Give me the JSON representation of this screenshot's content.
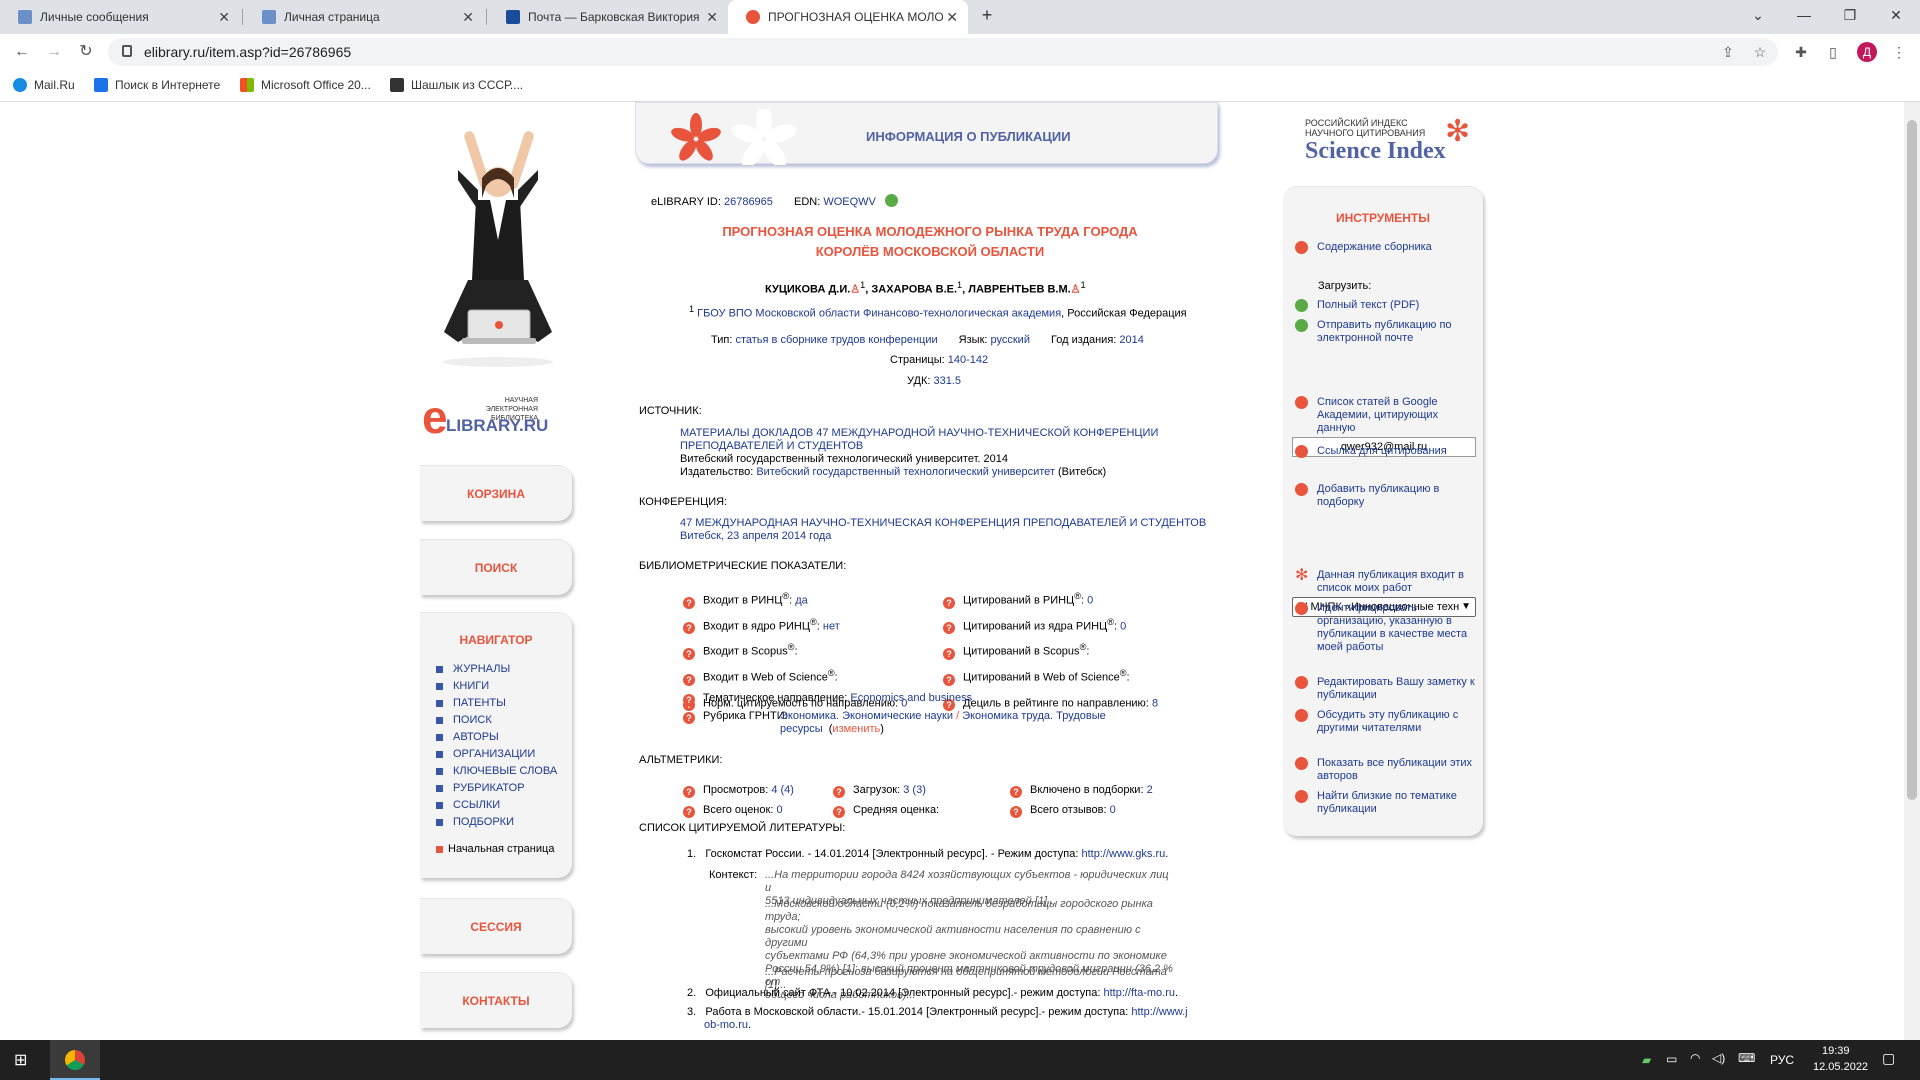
{
  "browser": {
    "tabs": [
      {
        "label": "Личные сообщения",
        "active": false
      },
      {
        "label": "Личная страница",
        "active": false
      },
      {
        "label": "Почта — Барковская Виктория",
        "active": false
      },
      {
        "label": "ПРОГНОЗНАЯ ОЦЕНКА МОЛОД",
        "active": true
      }
    ],
    "new_tab": "+",
    "url": "elibrary.ru/item.asp?id=26786965",
    "avatar_letter": "Д",
    "bookmarks": [
      "Mail.Ru",
      "Поиск в Интернете",
      "Microsoft Office 20...",
      "Шашлык из СССР...."
    ]
  },
  "left": {
    "logo_small": "НАУЧНАЯ ЭЛЕКТРОННАЯ БИБЛИОТЕКА",
    "logo_big": "LIBRARY.RU",
    "logo_e": "e",
    "cart": "КОРЗИНА",
    "search": "ПОИСК",
    "navigator": {
      "title": "НАВИГАТОР",
      "items": [
        "ЖУРНАЛЫ",
        "КНИГИ",
        "ПАТЕНТЫ",
        "ПОИСК",
        "АВТОРЫ",
        "ОРГАНИЗАЦИИ",
        "КЛЮЧЕВЫЕ СЛОВА",
        "РУБРИКАТОР",
        "ССЫЛКИ",
        "ПОДБОРКИ"
      ],
      "home": "Начальная страница"
    },
    "session": "СЕССИЯ",
    "contacts": "КОНТАКТЫ"
  },
  "header_box": {
    "title": "ИНФОРМАЦИЯ О ПУБЛИКАЦИИ"
  },
  "pub": {
    "elibrary_id_label": "eLIBRARY ID:",
    "elibrary_id": "26786965",
    "edn_label": "EDN:",
    "edn": "WOEQWV",
    "title_line1": "ПРОГНОЗНАЯ ОЦЕНКА МОЛОДЕЖНОГО РЫНКА ТРУДА ГОРОДА",
    "title_line2": "КОРОЛЁВ МОСКОВСКОЙ ОБЛАСТИ",
    "authors": [
      "КУЦИКОВА Д.И.",
      "ЗАХАРОВА В.Е.",
      "ЛАВРЕНТЬЕВ В.М."
    ],
    "author_sup": "1",
    "affiliation_sup": "1",
    "affiliation": "ГБОУ ВПО Московской области Финансово-технологическая академия",
    "country": ", Российская Федерация",
    "type_label": "Тип:",
    "type": "статья в сборнике трудов конференции",
    "lang_label": "Язык:",
    "lang": "русский",
    "year_label": "Год издания:",
    "year": "2014",
    "pages_label": "Страницы:",
    "pages": "140-142",
    "udk_label": "УДК:",
    "udk": "331.5"
  },
  "source": {
    "heading": "ИСТОЧНИК:",
    "title1": "МАТЕРИАЛЫ ДОКЛАДОВ 47 МЕЖДУНАРОДНОЙ НАУЧНО-ТЕХНИЧЕСКОЙ КОНФЕРЕНЦИИ",
    "title2": "ПРЕПОДАВАТЕЛЕЙ И СТУДЕНТОВ",
    "org": "Витебский государственный технологический университет. 2014",
    "publisher_label": "Издательство:",
    "publisher": "Витебский государственный технологический университет",
    "publisher_city": " (Витебск)"
  },
  "conference": {
    "heading": "КОНФЕРЕНЦИЯ:",
    "name": "47 МЕЖДУНАРОДНАЯ НАУЧНО-ТЕХНИЧЕСКАЯ КОНФЕРЕНЦИЯ ПРЕПОДАВАТЕЛЕЙ И СТУДЕНТОВ",
    "place": "Витебск, 23 апреля 2014 года"
  },
  "biblio": {
    "heading": "БИБЛИОМЕТРИЧЕСКИЕ ПОКАЗАТЕЛИ:",
    "left": [
      {
        "label": "Входит в РИНЦ",
        "sup": "®",
        "sep": ": ",
        "value": "да"
      },
      {
        "label": "Входит в ядро РИНЦ",
        "sup": "®",
        "sep": ": ",
        "value": "нет"
      },
      {
        "label": "Входит в Scopus",
        "sup": "®",
        "sep": ":",
        "value": ""
      },
      {
        "label": "Входит в Web of Science",
        "sup": "®",
        "sep": ":",
        "value": ""
      },
      {
        "label": "Норм. цитируемость по направлению:",
        "sup": "",
        "sep": " ",
        "value": "0"
      }
    ],
    "right": [
      {
        "label": "Цитирований в РИНЦ",
        "sup": "®",
        "sep": ": ",
        "value": "0"
      },
      {
        "label": "Цитирований из ядра РИНЦ",
        "sup": "®",
        "sep": ": ",
        "value": "0"
      },
      {
        "label": "Цитирований в Scopus",
        "sup": "®",
        "sep": ":",
        "value": ""
      },
      {
        "label": "Цитирований в Web of Science",
        "sup": "®",
        "sep": ":",
        "value": ""
      },
      {
        "label": "Дециль в рейтинге по направлению:",
        "sup": "",
        "sep": " ",
        "value": "8"
      }
    ],
    "theme_label": "Тематическое направление:",
    "theme": "Economics and business",
    "grnti_label": "Рубрика ГРНТИ:",
    "grnti1": "Экономика. Экономические науки",
    "grnti_sep": " / ",
    "grnti2a": "Экономика труда. Трудовые",
    "grnti2b": "ресурсы",
    "change": "изменить"
  },
  "altmetrics": {
    "heading": "АЛЬТМЕТРИКИ:",
    "views_label": "Просмотров:",
    "views": "4 (4)",
    "downloads_label": "Загрузок:",
    "downloads": "3 (3)",
    "collections_label": "Включено в подборки:",
    "collections": "2",
    "ratings_label": "Всего оценок:",
    "ratings": "0",
    "avg_label": "Средняя оценка:",
    "avg": "",
    "reviews_label": "Всего отзывов:",
    "reviews": "0"
  },
  "refs": {
    "heading": "СПИСОК ЦИТИРУЕМОЙ ЛИТЕРАТУРЫ:",
    "r1_num": "1.",
    "r1_text": "Госкомстат России. - 14.01.2014 [Электронный ресурс]. - Режим доступа: ",
    "r1_link": "http://www.gks.ru",
    "r1_end": ".",
    "context_label": "Контекст:",
    "ctx1a": "...На территории города 8424 хозяйствующих субъектов - юридических лиц и",
    "ctx1b": "5513 индивидуальных частных предпринимателей [1]...",
    "ctx2a": "...Московской области (0,2%) показатель безработицы городского рынка труда;",
    "ctx2b": "высокий уровень экономической активности населения по сравнению с другими",
    "ctx2c": "субъектами РФ (64,3% при уровне экономической активности по экономике",
    "ctx2d": "России 54,9%) [1]; высокий процент маятниковой трудовой миграции (36,2 % от",
    "ctx2e": "общего числа работников)...",
    "ctx3": "...Расчеты прогноза базируются на общепринятой методологии Росстата [1]...",
    "r2_num": "2.",
    "r2_text": "Официальный сайт ФТА.- 10.02.2014 [Электронный ресурс].- режим доступа: ",
    "r2_link": "http://fta-mo.ru",
    "r2_end": ".",
    "r3_num": "3.",
    "r3_text": "Работа в Московской области.- 15.01.2014 [Электронный ресурс].- режим доступа: ",
    "r3_link1": "http://www.j",
    "r3_link2": "ob-mo.ru",
    "r3_end": "."
  },
  "right": {
    "sci_small1": "РОССИЙСКИЙ ИНДЕКС",
    "sci_small2": "НАУЧНОГО ЦИТИРОВАНИЯ",
    "sci_big": "Science Index",
    "tools_title": "ИНСТРУМЕНТЫ",
    "contents": "Содержание сборника",
    "download_label": "Загрузить:",
    "fulltext": "Полный текст (PDF)",
    "send_email": "Отправить публикацию по электронной почте",
    "email_value": "qwer932@mail.ru",
    "google": "Список статей в Google Академии, цитирующих данную",
    "cite_link": "Ссылка для цитирования",
    "add_collection": "Добавить публикацию в подборку",
    "select_value": "IV МНПК «Инновационные техн",
    "my_works": "Данная публикация входит в список моих работ",
    "identify_org": "Идентифицировать организацию, указанную в публикации в качестве места моей работы",
    "edit_note": "Редактировать Вашу заметку к публикации",
    "discuss": "Обсудить эту публикацию с другими читателями",
    "show_all": "Показать все публикации этих авторов",
    "similar": "Найти близкие по тематике публикации"
  },
  "taskbar": {
    "lang": "РУС",
    "time": "19:39",
    "date": "12.05.2022"
  },
  "colors": {
    "accent": "#e8543c",
    "link": "#1d3a8f",
    "panel": "#f4f4f4"
  }
}
